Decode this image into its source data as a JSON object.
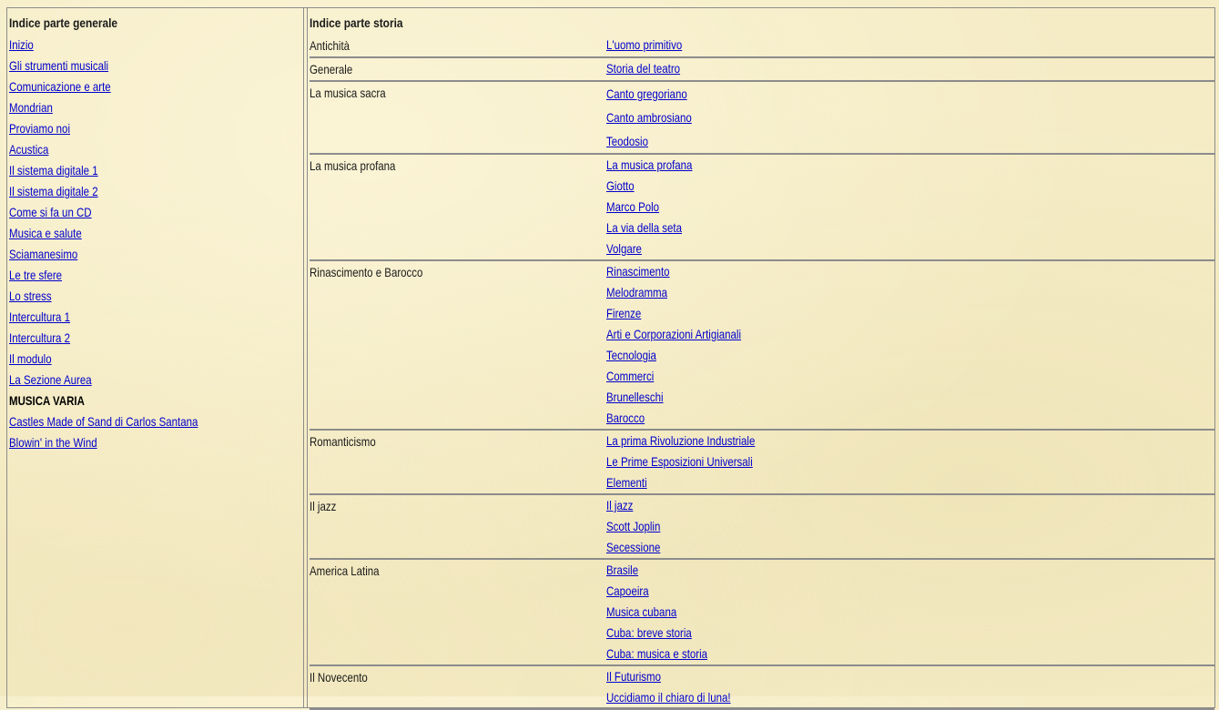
{
  "general": {
    "title": "Indice parte generale",
    "items": [
      {
        "label": "Inizio",
        "link": true
      },
      {
        "label": "Gli strumenti musicali",
        "link": true
      },
      {
        "label": "Comunicazione e arte",
        "link": true
      },
      {
        "label": "Mondrian",
        "link": true
      },
      {
        "label": "Proviamo noi",
        "link": true
      },
      {
        "label": "Acustica",
        "link": true
      },
      {
        "label": "Il sistema digitale 1",
        "link": true
      },
      {
        "label": "Il sistema digitale 2",
        "link": true
      },
      {
        "label": "Come si fa un CD",
        "link": true
      },
      {
        "label": "Musica e salute",
        "link": true
      },
      {
        "label": "Sciamanesimo",
        "link": true
      },
      {
        "label": "Le tre sfere",
        "link": true
      },
      {
        "label": "Lo stress",
        "link": true
      },
      {
        "label": "Intercultura 1",
        "link": true
      },
      {
        "label": "Intercultura 2",
        "link": true
      },
      {
        "label": "Il modulo",
        "link": true
      },
      {
        "label": "La Sezione Aurea",
        "link": true
      },
      {
        "label": "MUSICA VARIA",
        "link": false
      },
      {
        "label": "Castles Made of Sand di Carlos Santana",
        "link": true
      },
      {
        "label": "Blowin' in the Wind",
        "link": true
      }
    ]
  },
  "history": {
    "title": "Indice parte storia",
    "periods": [
      {
        "name": "Antichità",
        "topics": [
          "L'uomo primitivo"
        ]
      },
      {
        "name": "Generale",
        "topics": [
          "Storia del teatro"
        ]
      },
      {
        "name": "La musica sacra",
        "topics": [
          "Canto gregoriano",
          "Canto ambrosiano",
          "Teodosio"
        ],
        "spaced": true
      },
      {
        "name": "La musica profana",
        "topics": [
          "La musica profana",
          "Giotto",
          "Marco Polo",
          "La via della seta",
          "Volgare"
        ]
      },
      {
        "name": "Rinascimento e Barocco",
        "topics": [
          "Rinascimento",
          "Melodramma",
          "Firenze",
          "Arti e Corporazioni Artigianali",
          "Tecnologia",
          "Commerci",
          "Brunelleschi",
          "Barocco"
        ]
      },
      {
        "name": "Romanticismo",
        "topics": [
          "La prima Rivoluzione Industriale",
          "Le Prime Esposizioni Universali",
          "Elementi"
        ]
      },
      {
        "name": "Il jazz",
        "topics": [
          "Il jazz",
          "Scott Joplin",
          "Secessione"
        ]
      },
      {
        "name": "America Latina",
        "topics": [
          "Brasile",
          "Capoeira",
          "Musica cubana",
          "Cuba: breve storia",
          "Cuba: musica e storia"
        ]
      },
      {
        "name": "Il Novecento",
        "topics": [
          "Il Futurismo",
          "Uccidiamo il chiaro di luna!"
        ]
      }
    ]
  }
}
